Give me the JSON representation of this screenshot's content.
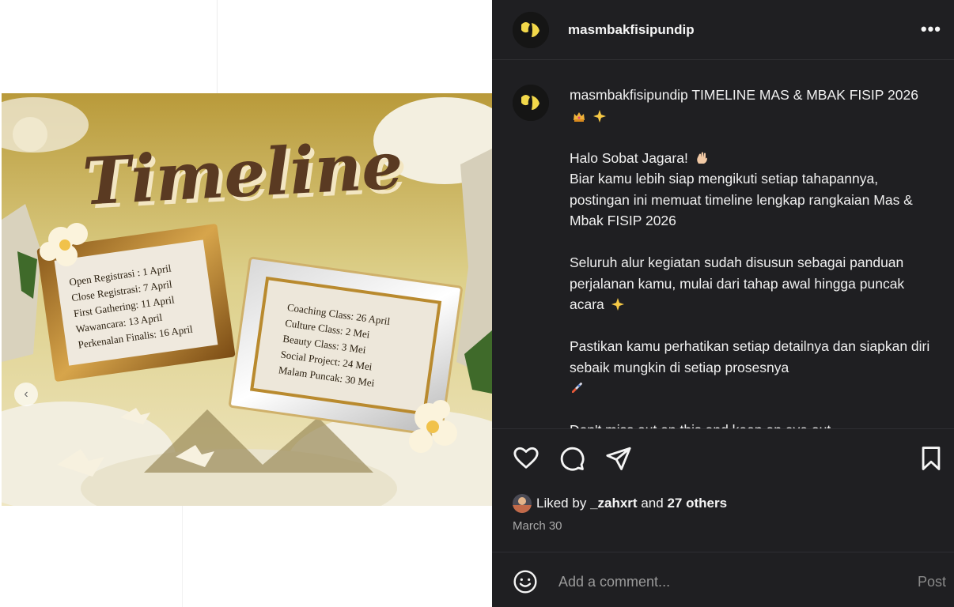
{
  "header": {
    "username": "masmbakfisipundip",
    "more_label": "•••"
  },
  "image": {
    "title": "Timeline",
    "left_frame": [
      "Open Registrasi : 1 April",
      "Close Registrasi: 7 April",
      "First Gathering: 11 April",
      "Wawancara: 13 April",
      "Perkenalan Finalis: 16 April"
    ],
    "right_frame": [
      "Coaching Class: 26 April",
      "Culture Class: 2 Mei",
      "Beauty Class: 3 Mei",
      "Social Project: 24 Mei",
      "Malam Puncak: 30 Mei"
    ],
    "prev_label": "‹"
  },
  "caption": {
    "username": "masmbakfisipundip",
    "line1": "TIMELINE MAS & MBAK FISIP 2026",
    "p2_line1": "Halo Sobat Jagara!",
    "p2_rest": "Biar kamu lebih siap mengikuti setiap tahapannya, postingan ini memuat timeline lengkap rangkaian Mas & Mbak FISIP 2026",
    "p3": "Seluruh alur kegiatan sudah disusun sebagai panduan perjalanan kamu, mulai dari tahap awal hingga puncak acara",
    "p4": "Pastikan kamu perhatikan setiap detailnya dan siapkan diri sebaik mungkin di setiap prosesnya",
    "p5": "Don't miss out on this and keep an eye out"
  },
  "likes": {
    "prefix": "Liked by",
    "user": "_zahxrt",
    "and": "and",
    "others": "27 others"
  },
  "date": "March 30",
  "comment": {
    "placeholder": "Add a comment...",
    "post_label": "Post"
  },
  "colors": {
    "panel_bg": "#1f1f22",
    "text": "#f5f5f5",
    "muted": "#a8a8a8"
  }
}
